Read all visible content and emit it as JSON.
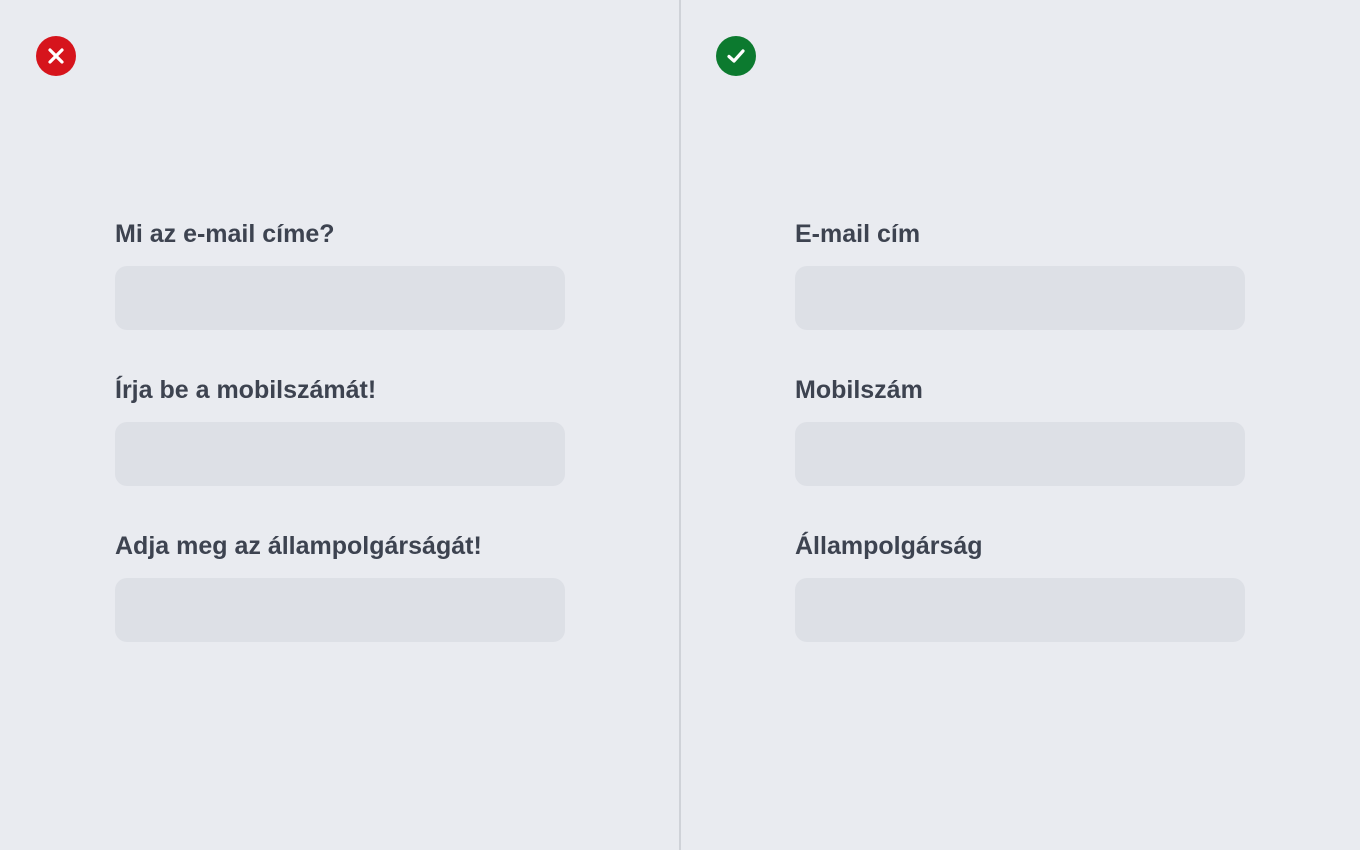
{
  "bad_example": {
    "status_icon": "close-icon",
    "fields": [
      {
        "label": "Mi az e-mail címe?",
        "value": ""
      },
      {
        "label": "Írja be a mobilszámát!",
        "value": ""
      },
      {
        "label": "Adja meg az állampolgárságát!",
        "value": ""
      }
    ]
  },
  "good_example": {
    "status_icon": "check-icon",
    "fields": [
      {
        "label": "E-mail cím",
        "value": ""
      },
      {
        "label": "Mobilszám",
        "value": ""
      },
      {
        "label": "Állampolgárság",
        "value": ""
      }
    ]
  },
  "colors": {
    "background": "#e9ebf0",
    "bad_badge": "#d6141c",
    "good_badge": "#0c7a2f",
    "label_text": "#3d4350",
    "input_fill": "#dde0e6",
    "divider": "#cfd2d8"
  }
}
